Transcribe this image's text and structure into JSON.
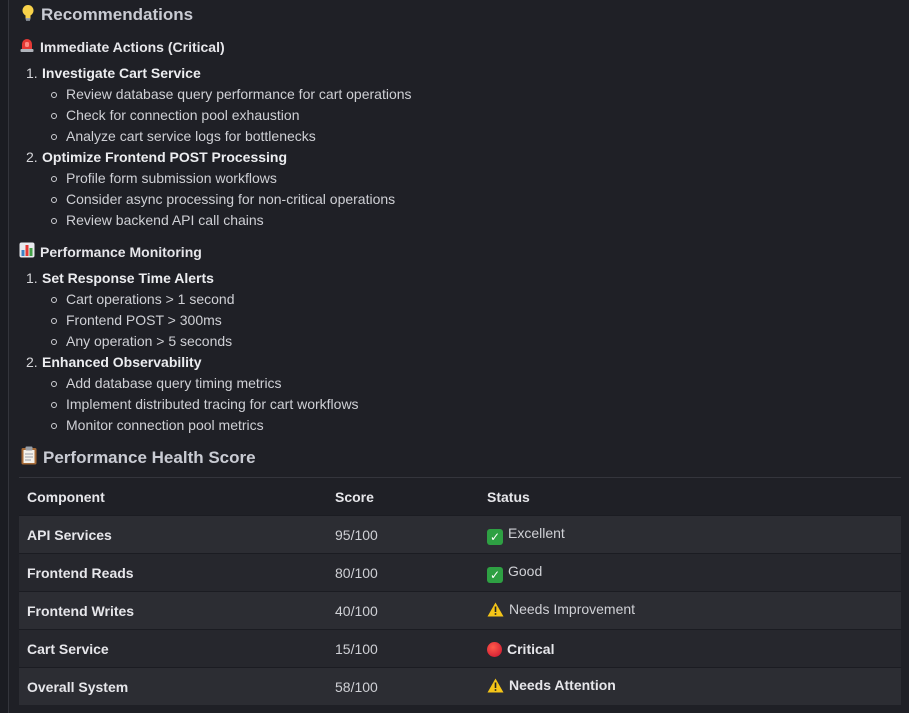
{
  "recommendations": {
    "title": "Recommendations",
    "icon": "lightbulb-icon",
    "immediate": {
      "title": "Immediate Actions (Critical)",
      "icon": "siren-icon",
      "items": [
        {
          "number": "1.",
          "title": "Investigate Cart Service",
          "bullets": [
            "Review database query performance for cart operations",
            "Check for connection pool exhaustion",
            "Analyze cart service logs for bottlenecks"
          ]
        },
        {
          "number": "2.",
          "title": "Optimize Frontend POST Processing",
          "bullets": [
            "Profile form submission workflows",
            "Consider async processing for non-critical operations",
            "Review backend API call chains"
          ]
        }
      ]
    },
    "monitoring": {
      "title": "Performance Monitoring",
      "icon": "bar-chart-icon",
      "items": [
        {
          "number": "1.",
          "title": "Set Response Time Alerts",
          "bullets": [
            "Cart operations > 1 second",
            "Frontend POST > 300ms",
            "Any operation > 5 seconds"
          ]
        },
        {
          "number": "2.",
          "title": "Enhanced Observability",
          "bullets": [
            "Add database query timing metrics",
            "Implement distributed tracing for cart workflows",
            "Monitor connection pool metrics"
          ]
        }
      ]
    }
  },
  "health": {
    "title": "Performance Health Score",
    "icon": "clipboard-icon",
    "columns": [
      "Component",
      "Score",
      "Status"
    ],
    "rows": [
      {
        "component": "API Services",
        "score": "95/100",
        "status": "Excellent",
        "status_icon": "check-icon",
        "bold": false
      },
      {
        "component": "Frontend Reads",
        "score": "80/100",
        "status": "Good",
        "status_icon": "check-icon",
        "bold": false
      },
      {
        "component": "Frontend Writes",
        "score": "40/100",
        "status": "Needs Improvement",
        "status_icon": "warning-icon",
        "bold": false
      },
      {
        "component": "Cart Service",
        "score": "15/100",
        "status": "Critical",
        "status_icon": "red-circle-icon",
        "bold": true
      },
      {
        "component": "Overall System",
        "score": "58/100",
        "status": "Needs Attention",
        "status_icon": "warning-icon",
        "bold": true
      }
    ]
  },
  "colors": {
    "background": "#1f2026",
    "row_odd": "#2c2d33",
    "row_even": "#26272d",
    "check_green": "#2ea043",
    "critical_red": "#c8102e",
    "warning_yellow": "#f5c518"
  }
}
